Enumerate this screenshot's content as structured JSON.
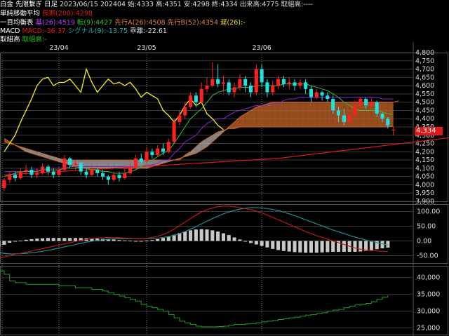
{
  "header": {
    "line1": {
      "instrument": "白金 先限繋ぎ 日足",
      "date": "2023/06/15",
      "contract": "202404",
      "open": "始:4333",
      "high": "高:4351",
      "low": "安:4298",
      "close": "終:4334",
      "volume": "出来高:4775",
      "oi": "取組高:----"
    },
    "line2": {
      "label": "単純移動平均",
      "ma_label": "長期(200):4298"
    },
    "line3": {
      "label": "一目均衡表",
      "kijun": "基(26):4519",
      "tenkan": "転(9):4427",
      "senkou_a": "先行A(26):4508",
      "senkou_b": "先行B(52):4354",
      "chikou": "遅(26):-"
    },
    "line4": {
      "label": "MACD",
      "macd": "MACD:-36.37",
      "signal": "シグナル(9):-13.75",
      "diff": "乖離:-22.61"
    },
    "line5": {
      "label": "取組高",
      "oi": "取組高:-"
    }
  },
  "colors": {
    "background": "#000000",
    "candle_up": "#ff2020",
    "candle_down": "#20e0e0",
    "kijun": "#9020e0",
    "tenkan": "#30c030",
    "chikou": "#e8e020",
    "ma200": "#e01818",
    "cloud_bull": "#c8662a",
    "cloud_bear": "#b0b0b0",
    "macd": "#c01818",
    "signal": "#209090",
    "oi_line": "#20a020",
    "price_tag": "#e01818"
  },
  "last_price": "4,334",
  "x_axis": {
    "labels": [
      "23/04",
      "23/05",
      "23/06"
    ]
  },
  "chart_data": [
    {
      "type": "candlestick",
      "title": "白金 先限繋ぎ 日足",
      "ylim": [
        3900,
        4800
      ],
      "y_ticks": [
        "4,800",
        "4,750",
        "4,700",
        "4,650",
        "4,600",
        "4,550",
        "4,500",
        "4,450",
        "4,400",
        "4,350",
        "4,300",
        "4,250",
        "4,200",
        "4,150",
        "4,100",
        "4,050",
        "4,000",
        "3,950",
        "3,900"
      ],
      "candles": [
        [
          3980,
          4030,
          3960,
          4040
        ],
        [
          4030,
          4060,
          4010,
          4080
        ],
        [
          4060,
          4040,
          4020,
          4080
        ],
        [
          4040,
          4080,
          4030,
          4100
        ],
        [
          4080,
          4090,
          4060,
          4120
        ],
        [
          4090,
          4060,
          4040,
          4110
        ],
        [
          4060,
          4070,
          4040,
          4100
        ],
        [
          4070,
          4110,
          4060,
          4130
        ],
        [
          4110,
          4080,
          4060,
          4120
        ],
        [
          4080,
          4060,
          4040,
          4100
        ],
        [
          4060,
          4090,
          4050,
          4110
        ],
        [
          4090,
          4160,
          4080,
          4180
        ],
        [
          4160,
          4120,
          4100,
          4170
        ],
        [
          4120,
          4130,
          4090,
          4150
        ],
        [
          4130,
          4080,
          4060,
          4140
        ],
        [
          4080,
          4060,
          4040,
          4100
        ],
        [
          4060,
          4090,
          4050,
          4110
        ],
        [
          4090,
          4070,
          4050,
          4100
        ],
        [
          4070,
          4050,
          4030,
          4090
        ],
        [
          4050,
          4030,
          4000,
          4060
        ],
        [
          4030,
          4060,
          4020,
          4080
        ],
        [
          4060,
          4040,
          4020,
          4080
        ],
        [
          4040,
          4070,
          4030,
          4100
        ],
        [
          4070,
          4100,
          4060,
          4130
        ],
        [
          4100,
          4160,
          4090,
          4180
        ],
        [
          4160,
          4140,
          4120,
          4190
        ],
        [
          4140,
          4200,
          4130,
          4230
        ],
        [
          4200,
          4180,
          4160,
          4220
        ],
        [
          4180,
          4220,
          4170,
          4240
        ],
        [
          4220,
          4200,
          4180,
          4250
        ],
        [
          4200,
          4260,
          4190,
          4280
        ],
        [
          4260,
          4380,
          4250,
          4400
        ],
        [
          4380,
          4420,
          4360,
          4450
        ],
        [
          4420,
          4470,
          4400,
          4500
        ],
        [
          4470,
          4540,
          4460,
          4560
        ],
        [
          4540,
          4500,
          4470,
          4560
        ],
        [
          4500,
          4580,
          4490,
          4620
        ],
        [
          4580,
          4600,
          4560,
          4650
        ],
        [
          4600,
          4640,
          4590,
          4740
        ],
        [
          4640,
          4610,
          4590,
          4730
        ],
        [
          4610,
          4620,
          4560,
          4660
        ],
        [
          4620,
          4560,
          4540,
          4640
        ],
        [
          4560,
          4590,
          4530,
          4620
        ],
        [
          4590,
          4640,
          4570,
          4670
        ],
        [
          4640,
          4600,
          4560,
          4660
        ],
        [
          4600,
          4560,
          4530,
          4620
        ],
        [
          4560,
          4700,
          4540,
          4730
        ],
        [
          4700,
          4620,
          4590,
          4730
        ],
        [
          4620,
          4560,
          4530,
          4640
        ],
        [
          4560,
          4600,
          4540,
          4630
        ],
        [
          4600,
          4640,
          4580,
          4660
        ],
        [
          4640,
          4610,
          4590,
          4660
        ],
        [
          4610,
          4620,
          4580,
          4650
        ],
        [
          4620,
          4600,
          4570,
          4640
        ],
        [
          4600,
          4620,
          4580,
          4640
        ],
        [
          4620,
          4580,
          4550,
          4640
        ],
        [
          4580,
          4530,
          4500,
          4600
        ],
        [
          4530,
          4560,
          4520,
          4580
        ],
        [
          4560,
          4540,
          4510,
          4570
        ],
        [
          4540,
          4520,
          4500,
          4560
        ],
        [
          4520,
          4450,
          4430,
          4540
        ],
        [
          4450,
          4420,
          4380,
          4470
        ],
        [
          4420,
          4380,
          4360,
          4460
        ],
        [
          4380,
          4420,
          4370,
          4450
        ],
        [
          4420,
          4480,
          4400,
          4510
        ],
        [
          4480,
          4520,
          4460,
          4530
        ],
        [
          4520,
          4480,
          4460,
          4530
        ],
        [
          4480,
          4500,
          4460,
          4520
        ],
        [
          4500,
          4430,
          4410,
          4510
        ],
        [
          4430,
          4400,
          4380,
          4440
        ],
        [
          4400,
          4360,
          4340,
          4410
        ],
        [
          4333,
          4334,
          4298,
          4351
        ]
      ],
      "kijun": [
        4080,
        4080,
        4080,
        4080,
        4080,
        4090,
        4090,
        4090,
        4100,
        4100,
        4100,
        4100,
        4110,
        4110,
        4110,
        4110,
        4110,
        4110,
        4110,
        4110,
        4110,
        4110,
        4110,
        4110,
        4110,
        4110,
        4120,
        4120,
        4130,
        4150,
        4150,
        4190,
        4220,
        4260,
        4280,
        4300,
        4340,
        4370,
        4390,
        4400,
        4400,
        4420,
        4440,
        4450,
        4460,
        4470,
        4480,
        4480,
        4480,
        4490,
        4490,
        4510,
        4520,
        4520,
        4530,
        4530,
        4530,
        4530,
        4530,
        4530,
        4530,
        4530,
        4530,
        4530,
        4530,
        4530,
        4530,
        4530,
        4530,
        4520,
        4520,
        4519
      ],
      "tenkan": [
        4050,
        4060,
        4070,
        4080,
        4080,
        4080,
        4080,
        4090,
        4090,
        4090,
        4090,
        4100,
        4100,
        4100,
        4100,
        4100,
        4090,
        4090,
        4080,
        4080,
        4070,
        4070,
        4070,
        4080,
        4090,
        4110,
        4130,
        4150,
        4170,
        4190,
        4210,
        4250,
        4300,
        4350,
        4400,
        4430,
        4460,
        4500,
        4540,
        4560,
        4570,
        4580,
        4580,
        4590,
        4590,
        4590,
        4600,
        4600,
        4600,
        4600,
        4600,
        4610,
        4610,
        4610,
        4610,
        4610,
        4600,
        4590,
        4580,
        4570,
        4550,
        4530,
        4500,
        4480,
        4460,
        4450,
        4450,
        4450,
        4450,
        4440,
        4430,
        4427
      ],
      "chikou": [
        4200,
        4250,
        4300,
        4380,
        4450,
        4520,
        4600,
        4640,
        4650,
        4600,
        4620,
        4620,
        4640,
        4600,
        4560,
        4700,
        4620,
        4560,
        4600,
        4640,
        4610,
        4620,
        4600,
        4620,
        4580,
        4530,
        4560,
        4540,
        4520,
        4450,
        4420,
        4380,
        4420,
        4480,
        4520,
        4480,
        4500,
        4430,
        4400,
        4360,
        4334
      ],
      "senkou_a": [
        4280,
        4260,
        4240,
        4220,
        4200,
        4190,
        4180,
        4170,
        4160,
        4150,
        4140,
        4130,
        4120,
        4110,
        4100,
        4100,
        4100,
        4100,
        4100,
        4100,
        4100,
        4100,
        4100,
        4100,
        4100,
        4100,
        4100,
        4110,
        4120,
        4130,
        4140,
        4150,
        4160,
        4170,
        4180,
        4190,
        4210,
        4230,
        4260,
        4290,
        4320,
        4350,
        4380,
        4410,
        4430,
        4450,
        4470,
        4480,
        4490,
        4500,
        4500,
        4500,
        4500,
        4500,
        4500,
        4500,
        4500,
        4500,
        4500,
        4500,
        4500,
        4500,
        4500,
        4500,
        4500,
        4500,
        4500,
        4500,
        4500,
        4500,
        4500,
        4500,
        4508
      ],
      "senkou_b": [
        4260,
        4250,
        4240,
        4230,
        4220,
        4210,
        4200,
        4190,
        4180,
        4170,
        4160,
        4150,
        4150,
        4150,
        4150,
        4150,
        4150,
        4150,
        4150,
        4150,
        4150,
        4150,
        4150,
        4150,
        4150,
        4150,
        4150,
        4150,
        4150,
        4150,
        4150,
        4150,
        4150,
        4180,
        4200,
        4230,
        4260,
        4280,
        4300,
        4320,
        4330,
        4340,
        4340,
        4350,
        4350,
        4350,
        4350,
        4350,
        4350,
        4350,
        4350,
        4350,
        4350,
        4350,
        4350,
        4350,
        4350,
        4350,
        4350,
        4350,
        4350,
        4350,
        4350,
        4350,
        4350,
        4350,
        4350,
        4350,
        4350,
        4350,
        4350,
        4354
      ],
      "ma200": [
        4060,
        4062,
        4064,
        4066,
        4068,
        4070,
        4072,
        4074,
        4076,
        4078,
        4080,
        4082,
        4084,
        4086,
        4088,
        4090,
        4092,
        4094,
        4096,
        4098,
        4100,
        4102,
        4104,
        4106,
        4108,
        4110,
        4112,
        4114,
        4116,
        4118,
        4120,
        4122,
        4124,
        4126,
        4128,
        4130,
        4132,
        4134,
        4136,
        4138,
        4140,
        4142,
        4144,
        4146,
        4148,
        4150,
        4152,
        4154,
        4156,
        4158,
        4160,
        4164,
        4168,
        4172,
        4176,
        4180,
        4184,
        4188,
        4192,
        4196,
        4200,
        4204,
        4208,
        4212,
        4216,
        4220,
        4224,
        4228,
        4232,
        4236,
        4240,
        4244,
        4248,
        4252,
        4256,
        4260,
        4264,
        4268,
        4272,
        4276,
        4280,
        4284,
        4288,
        4292,
        4296,
        4298
      ]
    },
    {
      "type": "line",
      "title": "MACD",
      "ylim": [
        -75,
        125
      ],
      "y_ticks": [
        "100.00",
        "50.00",
        "0.00",
        "-50.00"
      ],
      "series": [
        {
          "name": "MACD",
          "values": [
            -60,
            -55,
            -50,
            -45,
            -42,
            -38,
            -34,
            -30,
            -26,
            -22,
            -18,
            -14,
            -10,
            -6,
            -2,
            2,
            5,
            8,
            10,
            11,
            12,
            12,
            11,
            10,
            9,
            8,
            8,
            9,
            12,
            16,
            22,
            30,
            40,
            52,
            64,
            76,
            88,
            98,
            106,
            112,
            116,
            118,
            118,
            116,
            113,
            110,
            106,
            101,
            95,
            88,
            80,
            72,
            64,
            56,
            48,
            40,
            32,
            25,
            18,
            12,
            6,
            0,
            -6,
            -12,
            -18,
            -24,
            -28,
            -31,
            -33,
            -34,
            -35,
            -36.37
          ]
        },
        {
          "name": "シグナル(9)",
          "values": [
            -40,
            -42,
            -44,
            -44,
            -43,
            -42,
            -40,
            -38,
            -35,
            -32,
            -28,
            -24,
            -20,
            -16,
            -12,
            -8,
            -4,
            -1,
            2,
            4,
            6,
            7,
            8,
            8,
            8,
            8,
            8,
            8,
            9,
            10,
            12,
            15,
            19,
            25,
            32,
            40,
            49,
            58,
            67,
            76,
            84,
            92,
            98,
            104,
            108,
            111,
            113,
            113,
            112,
            110,
            107,
            103,
            98,
            92,
            86,
            79,
            72,
            65,
            58,
            51,
            44,
            37,
            31,
            25,
            19,
            13,
            8,
            3,
            -2,
            -6,
            -10,
            -13.75
          ]
        },
        {
          "name": "乖離",
          "values": [
            -20,
            -13,
            -6,
            -1,
            1,
            4,
            6,
            8,
            9,
            10,
            10,
            10,
            10,
            10,
            10,
            10,
            9,
            9,
            8,
            7,
            6,
            5,
            3,
            2,
            1,
            0,
            0,
            1,
            3,
            6,
            10,
            15,
            21,
            27,
            32,
            36,
            39,
            40,
            39,
            36,
            32,
            26,
            20,
            12,
            5,
            -1,
            -7,
            -12,
            -17,
            -22,
            -27,
            -31,
            -34,
            -36,
            -38,
            -39,
            -40,
            -40,
            -40,
            -39,
            -38,
            -37,
            -37,
            -37,
            -37,
            -37,
            -36,
            -34,
            -31,
            -28,
            -25,
            -22.61
          ]
        }
      ]
    },
    {
      "type": "line",
      "title": "取組高",
      "ylim": [
        23000,
        43500
      ],
      "y_ticks": [
        "40,000",
        "35,000",
        "30,000",
        "25,000"
      ],
      "series": [
        {
          "name": "取組高",
          "values": [
            42000,
            41000,
            39000,
            38500,
            38500,
            38000,
            38000,
            38000,
            38000,
            38000,
            38000,
            37500,
            37500,
            37500,
            37000,
            37000,
            37000,
            36500,
            36500,
            36000,
            35500,
            35000,
            34500,
            34000,
            33500,
            33000,
            32000,
            31500,
            31000,
            30500,
            30000,
            29000,
            28000,
            27000,
            26500,
            26000,
            25500,
            25300,
            25300,
            25300,
            25400,
            25500,
            25800,
            26000,
            26000,
            26200,
            26300,
            26500,
            26800,
            27000,
            27200,
            27500,
            27700,
            28000,
            28200,
            28500,
            28800,
            29000,
            29300,
            29500,
            30000,
            30300,
            30500,
            31000,
            31500,
            31800,
            32000,
            32300,
            32800,
            33500,
            34200,
            34700
          ]
        }
      ]
    }
  ]
}
